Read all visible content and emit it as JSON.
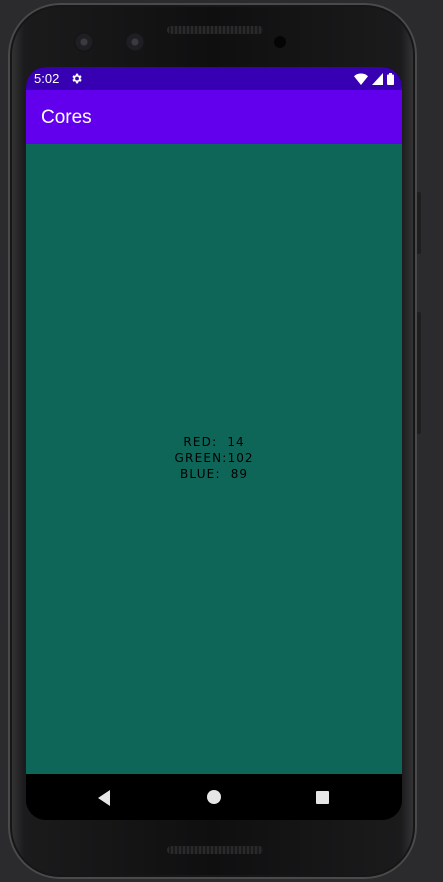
{
  "status_bar": {
    "time": "5:02",
    "icons": [
      "gear-icon",
      "wifi-icon",
      "signal-icon",
      "battery-icon"
    ],
    "color": "#3700b3"
  },
  "app_bar": {
    "title": "Cores",
    "color": "#6200ee"
  },
  "content": {
    "background_color": "#0e6659",
    "rows": [
      {
        "label": "RED:",
        "value": "14"
      },
      {
        "label": "GREEN:",
        "value": "102"
      },
      {
        "label": "BLUE:",
        "value": "89"
      }
    ]
  },
  "nav_bar": {
    "buttons": [
      "back-icon",
      "home-icon",
      "recents-icon"
    ]
  }
}
